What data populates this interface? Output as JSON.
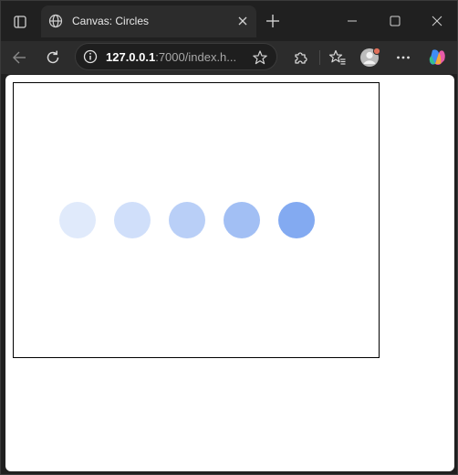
{
  "browser": {
    "tab": {
      "title": "Canvas: Circles",
      "favicon": "globe-icon",
      "close_icon": "close-icon"
    },
    "new_tab_icon": "plus-icon",
    "window_controls": [
      "minimize-icon",
      "maximize-icon",
      "close-icon"
    ],
    "address": {
      "host": "127.0.0.1",
      "rest": ":7000/index.h...",
      "info_icon": "info-icon",
      "favorite_icon": "star-icon"
    },
    "toolbar_icons": [
      "back-arrow-icon",
      "reload-icon",
      "extensions-icon",
      "favorites-icon",
      "profile-avatar",
      "more-icon",
      "copilot-icon"
    ]
  },
  "page": {
    "canvas": {
      "circle_color": "#6495ed",
      "circles": [
        {
          "opacity": 0.2
        },
        {
          "opacity": 0.3
        },
        {
          "opacity": 0.45
        },
        {
          "opacity": 0.6
        },
        {
          "opacity": 0.8
        }
      ]
    }
  },
  "colors": {
    "chrome_dark": "#202020",
    "toolbar": "#2c2c2c",
    "canvas_border": "#000000",
    "profile_dot": "#e0705a"
  }
}
